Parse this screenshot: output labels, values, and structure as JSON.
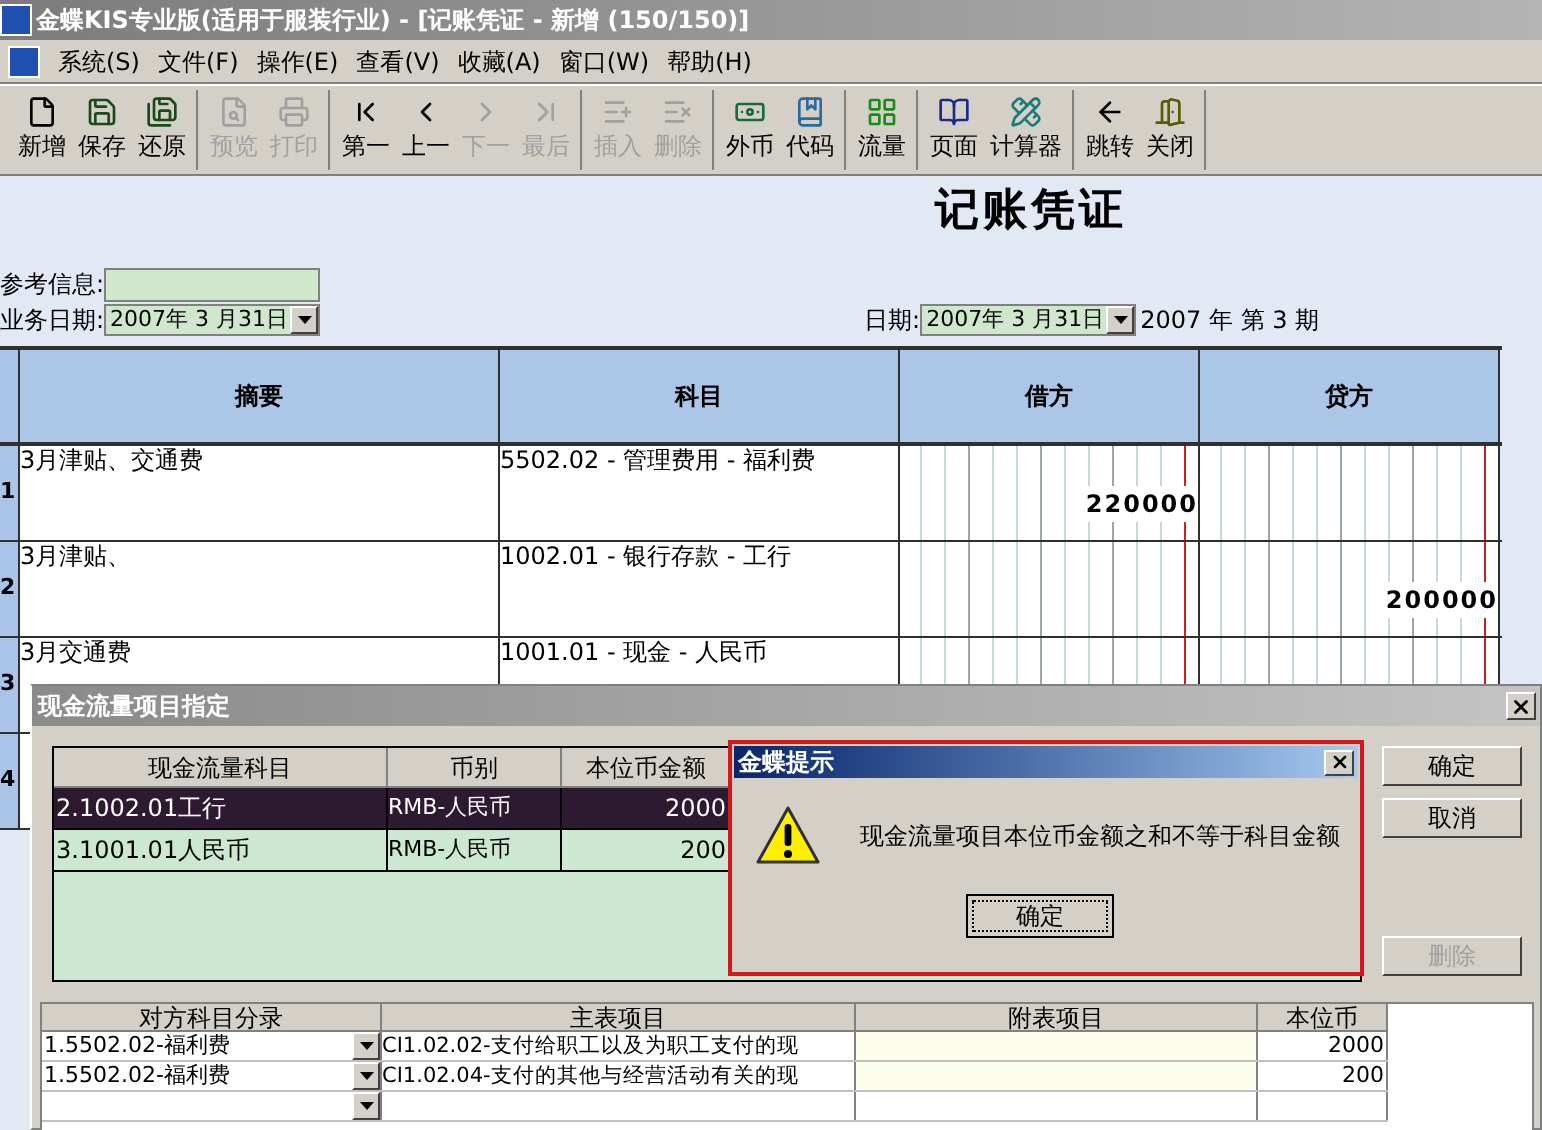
{
  "window": {
    "title": "金蝶KIS专业版(适用于服装行业) - [记账凭证 - 新增 (150/150)]"
  },
  "menu": [
    "系统(S)",
    "文件(F)",
    "操作(E)",
    "查看(V)",
    "收藏(A)",
    "窗口(W)",
    "帮助(H)"
  ],
  "toolbar_groups": [
    [
      {
        "label": "新增",
        "disabled": false
      },
      {
        "label": "保存",
        "disabled": false
      },
      {
        "label": "还原",
        "disabled": false
      }
    ],
    [
      {
        "label": "预览",
        "disabled": true
      },
      {
        "label": "打印",
        "disabled": true
      }
    ],
    [
      {
        "label": "第一",
        "disabled": false
      },
      {
        "label": "上一",
        "disabled": false
      },
      {
        "label": "下一",
        "disabled": true
      },
      {
        "label": "最后",
        "disabled": true
      }
    ],
    [
      {
        "label": "插入",
        "disabled": true
      },
      {
        "label": "删除",
        "disabled": true
      }
    ],
    [
      {
        "label": "外币",
        "disabled": false
      },
      {
        "label": "代码",
        "disabled": false
      }
    ],
    [
      {
        "label": "流量",
        "disabled": false
      }
    ],
    [
      {
        "label": "页面",
        "disabled": false
      },
      {
        "label": "计算器",
        "disabled": false
      }
    ],
    [
      {
        "label": "跳转",
        "disabled": false
      },
      {
        "label": "关闭",
        "disabled": false
      }
    ]
  ],
  "voucher": {
    "title": "记账凭证",
    "reference_label": "参考信息:",
    "business_date_label": "业务日期:",
    "business_date": "2007年 3 月31日",
    "date_label": "日期:",
    "date": "2007年 3 月31日",
    "period": "2007 年 第 3 期"
  },
  "entries": {
    "columns": [
      "摘要",
      "科目",
      "借方",
      "贷方"
    ],
    "rows": [
      {
        "no": "1",
        "summary": "3月津贴、交通费",
        "account": "5502.02 - 管理费用 - 福利费",
        "debit": "220000"
      },
      {
        "no": "2",
        "summary": "3月津贴、",
        "account": "1002.01 - 银行存款 - 工行",
        "credit": "200000"
      },
      {
        "no": "3",
        "summary": "3月交通费",
        "account": "1001.01 - 现金 - 人民币"
      },
      {
        "no": "4"
      }
    ]
  },
  "cashflow_dialog": {
    "title": "现金流量项目指定",
    "grid": {
      "columns": [
        "现金流量科目",
        "币别",
        "本位币金额"
      ],
      "rows": [
        {
          "account": "2.1002.01工行",
          "currency": "RMB-人民币",
          "amount": "2000",
          "selected": true
        },
        {
          "account": "3.1001.01人民币",
          "currency": "RMB-人民币",
          "amount": "200",
          "selected": false
        }
      ]
    },
    "buttons": [
      {
        "label": "确定",
        "disabled": false
      },
      {
        "label": "取消",
        "disabled": false
      },
      {
        "label": "删除",
        "disabled": true
      }
    ],
    "items": {
      "columns": [
        "对方科目分录",
        "主表项目",
        "附表项目",
        "本位币"
      ],
      "rows": [
        {
          "account": "1.5502.02-福利费",
          "main_item": "CI1.02.02-支付给职工以及为职工支付的现",
          "amount": "2000"
        },
        {
          "account": "1.5502.02-福利费",
          "main_item": "CI1.02.04-支付的其他与经营活动有关的现",
          "amount": "200"
        },
        {}
      ]
    }
  },
  "alert": {
    "title": "金蝶提示",
    "message": "现金流量项目本位币金额之和不等于科目金额",
    "button": "确定"
  }
}
